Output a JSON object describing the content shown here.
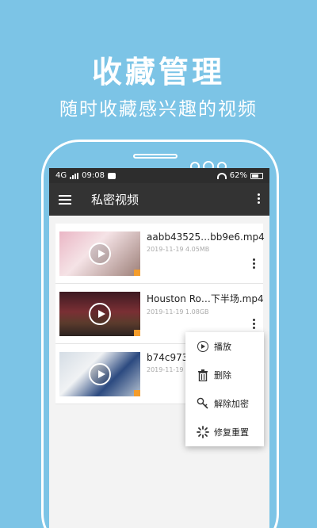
{
  "promo": {
    "title": "收藏管理",
    "subtitle": "随时收藏感兴趣的视频"
  },
  "status_bar": {
    "network": "4G",
    "time": "09:08",
    "battery": "62%"
  },
  "app_bar": {
    "title": "私密视频"
  },
  "videos": [
    {
      "name": "aabb43525…bb9e6.mp4",
      "meta": "2019-11-19  4.05MB"
    },
    {
      "name": "Houston Ro…下半场.mp4",
      "meta": "2019-11-19  1.08GB"
    },
    {
      "name": "b74c973",
      "meta": "2019-11-19"
    }
  ],
  "context_menu": {
    "items": [
      "播放",
      "删除",
      "解除加密",
      "修复重置"
    ]
  },
  "colors": {
    "background": "#7cc4e6",
    "app_bar": "#333333",
    "status_bar": "#2d2d2d",
    "thumb_badge": "#f39c2b"
  }
}
